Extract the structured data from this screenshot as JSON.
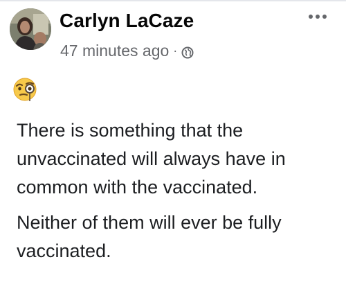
{
  "post": {
    "author": "Carlyn LaCaze",
    "timestamp": "47 minutes ago",
    "separator": "·",
    "privacy_icon": "globe-icon",
    "more_icon": "more-options-icon",
    "emoji": "face-with-monocle-emoji",
    "paragraphs": [
      {
        "lines": [
          "There is something that the",
          "unvaccinated will always have in",
          "common with the vaccinated."
        ]
      },
      {
        "lines": [
          "Neither of them will ever be fully",
          "vaccinated."
        ]
      }
    ]
  },
  "colors": {
    "name": "#050505",
    "meta": "#65676b",
    "body_text": "#1c1e21",
    "background": "#ffffff"
  }
}
